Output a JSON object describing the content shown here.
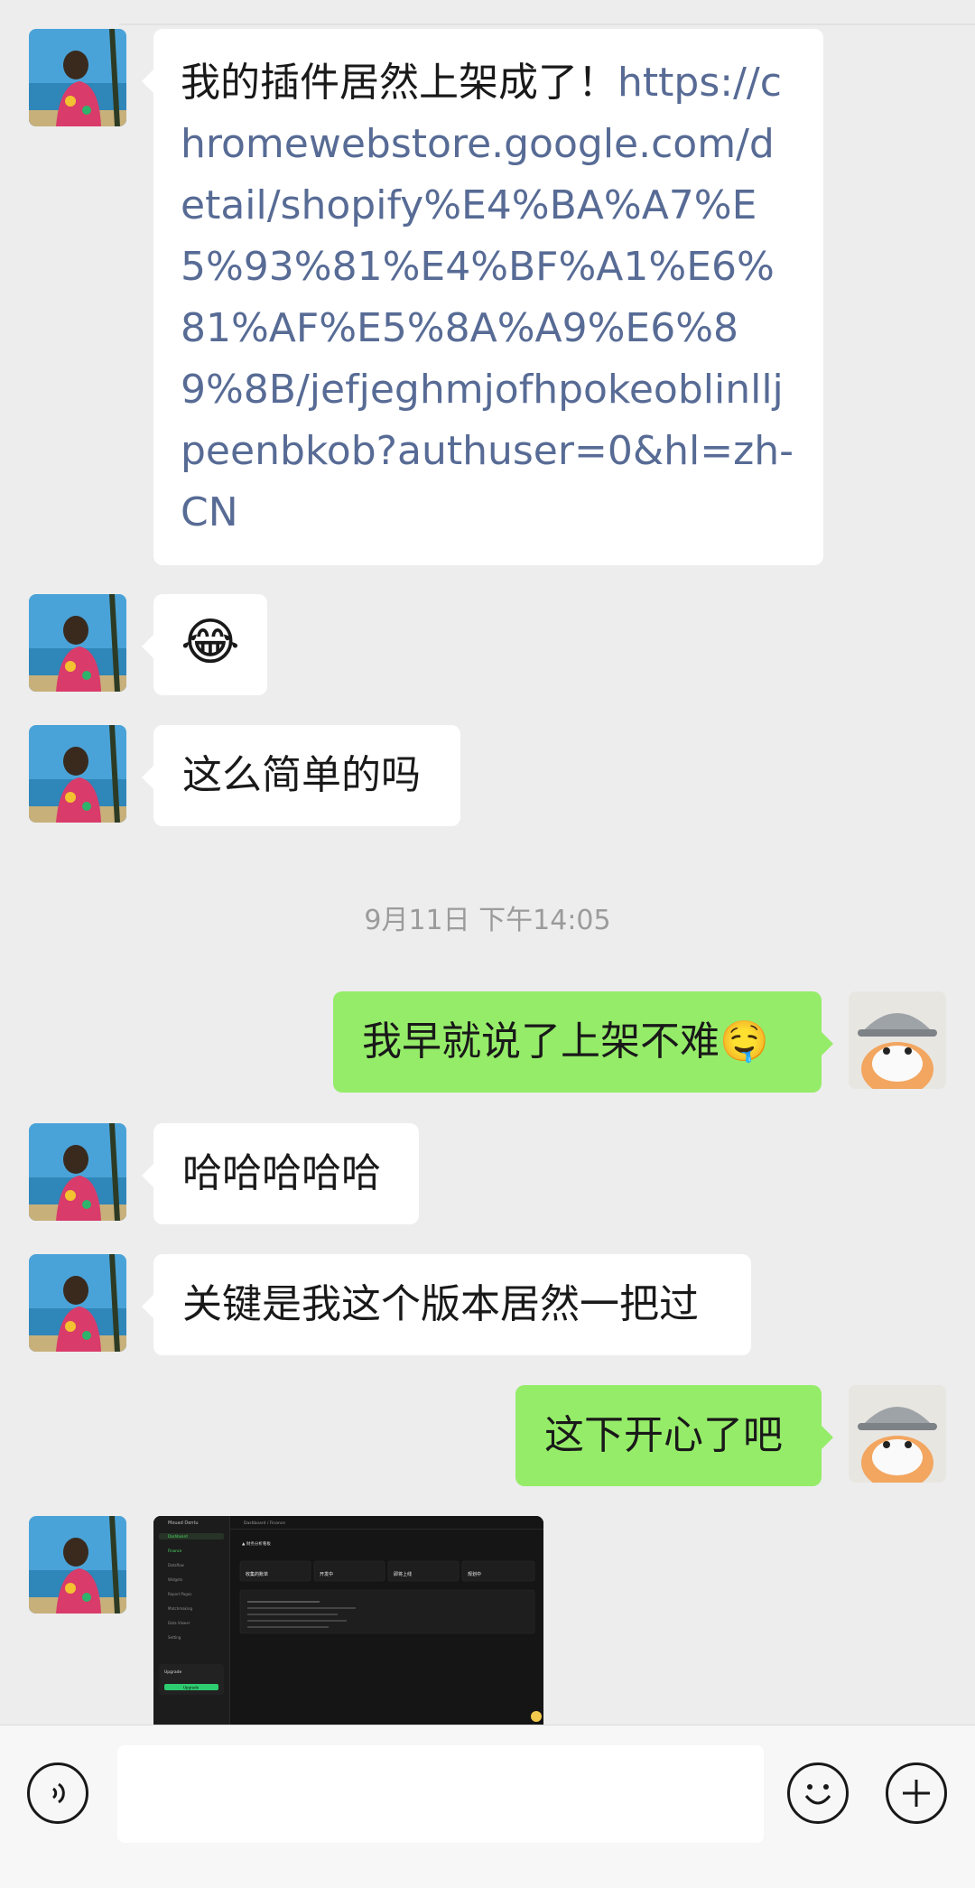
{
  "messages": {
    "m1_prefix": "我的插件居然上架成了！",
    "m1_link": "https://chromewebstore.google.com/detail/shopify%E4%BA%A7%E5%93%81%E4%BF%A1%E6%81%AF%E5%8A%A9%E6%89%8B/jefjeghmjofhpokeoblinlljpeenbkob?authuser=0&hl=zh-CN",
    "m2_emoji": "😂",
    "m3": "这么简单的吗",
    "timestamp": "9月11日 下午14:05",
    "m4": "我早就说了上架不难",
    "m4_emoji": "🤤",
    "m5": "哈哈哈哈哈",
    "m6": "关键是我这个版本居然一把过",
    "m7": "这下开心了吧"
  },
  "screenshot": {
    "app_name": "Mouad Dentu",
    "breadcrumb": "Dashboard / Finance",
    "heading": "▲ 财务分析看板",
    "cards": [
      "收集的账单",
      "开发中",
      "即将上线",
      "规划中"
    ],
    "upgrade_title": "Upgrade",
    "upgrade_button": "Upgrade",
    "sidebar_items": [
      "Dashboard",
      "Finance",
      "Dataflow",
      "Widgets",
      "Report Pages",
      "Matchmaking",
      "Data Viewer",
      "Setting"
    ]
  },
  "input": {
    "placeholder": ""
  },
  "colors": {
    "background": "#ededed",
    "self_bubble": "#95ec69",
    "other_bubble": "#ffffff",
    "link": "#576b95"
  },
  "icons": [
    "voice-icon",
    "emoji-icon",
    "plus-icon"
  ]
}
